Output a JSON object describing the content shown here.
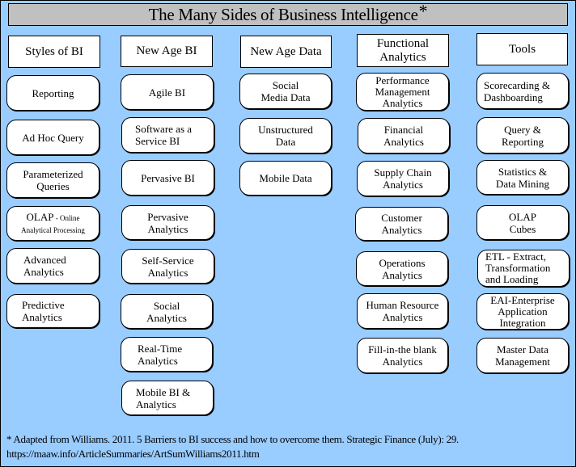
{
  "title": "The Many Sides of Business Intelligence",
  "title_mark": "*",
  "columns": [
    {
      "header": "Styles of BI",
      "items": [
        "Reporting",
        "Ad Hoc Query",
        "Parameterized Queries",
        "OLAP - Online Analytical Processing",
        "Advanced Analytics",
        "Predictive Analytics"
      ]
    },
    {
      "header": "New Age BI",
      "items": [
        "Agile BI",
        "Software as a Service BI",
        "Pervasive BI",
        "Pervasive Analytics",
        "Self-Service Analytics",
        "Social Analytics",
        "Real-Time Analytics",
        "Mobile BI & Analytics"
      ]
    },
    {
      "header": "New Age Data",
      "items": [
        "Social Media Data",
        "Unstructured Data",
        "Mobile Data"
      ]
    },
    {
      "header": "Functional Analytics",
      "items": [
        "Performance Management Analytics",
        "Financial Analytics",
        "Supply Chain Analytics",
        "Customer Analytics",
        "Operations Analytics",
        "Human Resource Analytics",
        "Fill-in-the blank Analytics"
      ]
    },
    {
      "header": "Tools",
      "items": [
        "Scorecarding & Dashboarding",
        "Query & Reporting",
        "Statistics & Data Mining",
        "OLAP Cubes",
        "ETL - Extract, Transformation and Loading",
        "EAI-Enterprise Application Integration",
        "Master Data Management"
      ]
    }
  ],
  "olap_main": "OLAP",
  "olap_sub_a": " - Online",
  "olap_sub_b": "Analytical Processing",
  "footnote": {
    "line1": "* Adapted from Williams. 2011. 5 Barriers to BI success and how to overcome them. Strategic Finance (July): 29.",
    "line2": "https://maaw.info/ArticleSummaries/ArtSumWilliams2011.htm"
  }
}
